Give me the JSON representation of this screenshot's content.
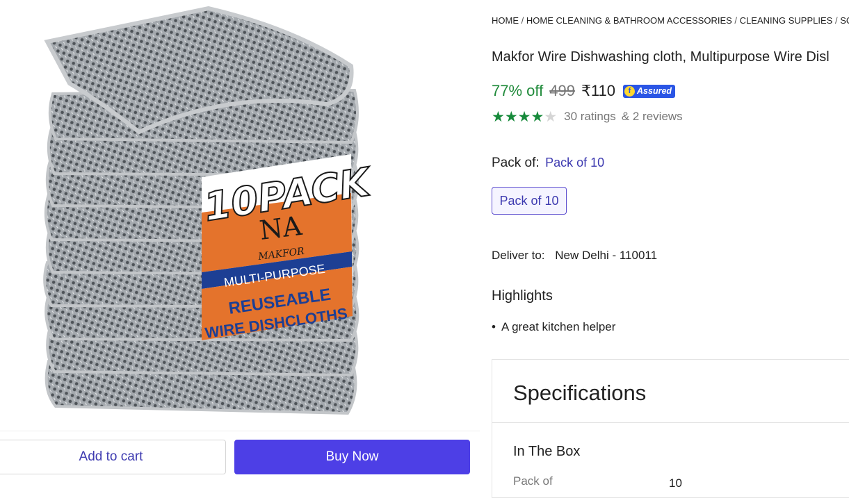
{
  "product_image": {
    "pack_text": "10PACK",
    "brand_text": "MAKFOR",
    "line1": "MULTI-PURPOSE",
    "line2": "REUSEABLE",
    "line3": "WIRE DISHCLOTHS",
    "colors": {
      "label_orange": "#e4732c",
      "label_blue": "#1d3f94",
      "cloth_grey": "#9da3aa"
    }
  },
  "actions": {
    "add_to_cart": "Add to cart",
    "buy_now": "Buy Now"
  },
  "breadcrumb": [
    "HOME",
    "HOME CLEANING & BATHROOM ACCESSORIES",
    "CLEANING SUPPLIES",
    "SCRU"
  ],
  "breadcrumb_sep": "/",
  "product": {
    "title": "Makfor Wire Dishwashing cloth, Multipurpose Wire Disl",
    "discount": "77% off",
    "mrp": "499",
    "price": "₹110",
    "assured_label": "Assured",
    "rating_stars": 4,
    "rating_max": 5,
    "ratings_text": "30 ratings",
    "reviews_text": "& 2 reviews"
  },
  "pack": {
    "label": "Pack of:",
    "value": "Pack of 10",
    "chip": "Pack of 10"
  },
  "delivery": {
    "label": "Deliver to:",
    "location": "New Delhi - 110011"
  },
  "highlights": {
    "title": "Highlights",
    "items": [
      "A great kitchen helper"
    ]
  },
  "specifications": {
    "title": "Specifications",
    "group": "In The Box",
    "rows": [
      {
        "key": "Pack of",
        "value": "10"
      }
    ]
  },
  "colors": {
    "accent": "#4d3fe6",
    "discount_green": "#1f8a3a",
    "star_green": "#168a3a",
    "link_blue": "#3d3ab0"
  }
}
